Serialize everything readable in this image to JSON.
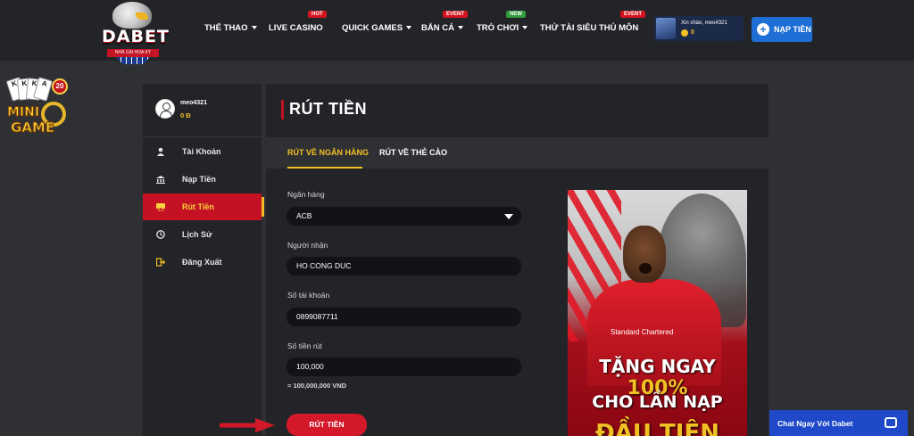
{
  "brand": {
    "name": "DABET",
    "tagline": "NHÀ CÁI HOA KỲ"
  },
  "nav": {
    "items": [
      {
        "label": "THỂ THAO",
        "badge": "",
        "caret": true
      },
      {
        "label": "LIVE CASINO",
        "badge": "HOT",
        "caret": false
      },
      {
        "label": "QUICK GAMES",
        "badge": "",
        "caret": true
      },
      {
        "label": "BẮN CÁ",
        "badge": "EVENT",
        "caret": true
      },
      {
        "label": "TRÒ CHƠI",
        "badge": "NEW",
        "caret": true
      },
      {
        "label": "THỬ TÀI SIÊU THỦ MÔN",
        "badge": "EVENT",
        "caret": false
      }
    ]
  },
  "header_user": {
    "greeting": "Xin chào, meo4321",
    "balance": "0"
  },
  "deposit_button": {
    "label": "NẠP TIỀN"
  },
  "minigame": {
    "badge_number": "20",
    "word1": "MINI",
    "word2": "GAME",
    "cards": [
      "K",
      "K",
      "K",
      "A"
    ]
  },
  "sidebar": {
    "username": "meo4321",
    "balance": "0 Đ",
    "items": [
      {
        "label": "Tài Khoản",
        "icon": "user-icon",
        "active": false
      },
      {
        "label": "Nạp Tiền",
        "icon": "bank-icon",
        "active": false
      },
      {
        "label": "Rút Tiền",
        "icon": "withdraw-icon",
        "active": true
      },
      {
        "label": "Lịch Sử",
        "icon": "history-icon",
        "active": false
      },
      {
        "label": "Đăng Xuất",
        "icon": "logout-icon",
        "active": false
      }
    ]
  },
  "page": {
    "title": "RÚT TIỀN",
    "tabs": [
      {
        "label": "RÚT VỀ NGÂN HÀNG",
        "active": true
      },
      {
        "label": "RÚT VỀ THẺ CÀO",
        "active": false
      }
    ]
  },
  "form": {
    "bank_label": "Ngân hàng",
    "bank_value": "ACB",
    "recipient_label": "Người nhận",
    "recipient_value": "HO CONG DUC",
    "account_label": "Số tài khoản",
    "account_value": "0899087711",
    "amount_label": "Số tiền rút",
    "amount_value": "100,000",
    "conversion": "= 100,000,000 VND",
    "submit_label": "RÚT TIỀN"
  },
  "promo": {
    "line1_prefix": "TẶNG NGAY ",
    "line1_highlight": "100%",
    "line2": "CHO LẦN NẠP",
    "line3": "ĐẦU TIÊN",
    "sponsor": "Standard Chartered"
  },
  "chat": {
    "label": "Chat Ngay Với Dabet"
  },
  "colors": {
    "accent_red": "#c41224",
    "gold": "#f3c024",
    "blue": "#1f6ed6",
    "chat_blue": "#1f49c9"
  }
}
